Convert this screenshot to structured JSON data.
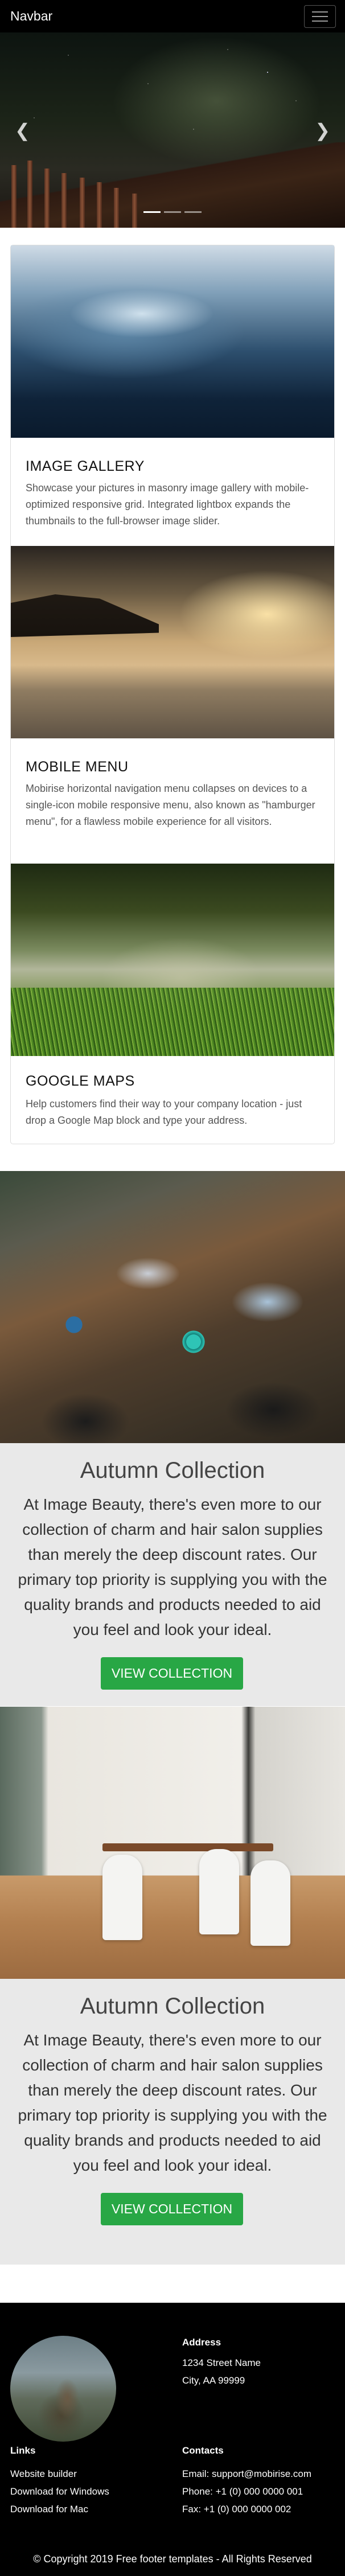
{
  "navbar": {
    "brand": "Navbar"
  },
  "cards": [
    {
      "title": "IMAGE GALLERY",
      "text": "Showcase your pictures in masonry image gallery with mobile-optimized responsive grid. Integrated lightbox expands the thumbnails to the full-browser image slider."
    },
    {
      "title": "MOBILE MENU",
      "text": "Mobirise horizontal navigation menu collapses on devices to a single-icon mobile responsive menu, also known as \"hamburger menu\", for a flawless mobile experience for all visitors."
    },
    {
      "title": "GOOGLE MAPS",
      "text": "Help customers find their way to your company location - just drop a Google Map block and type your address."
    }
  ],
  "sections": [
    {
      "title": "Autumn Collection",
      "text": "At Image Beauty, there's even more to our collection of charm and hair salon supplies than merely the deep discount rates. Our primary top priority is supplying you with the quality brands and products needed to aid you feel and look your ideal.",
      "button": "VIEW COLLECTION"
    },
    {
      "title": "Autumn Collection",
      "text": "At Image Beauty, there's even more to our collection of charm and hair salon supplies than merely the deep discount rates. Our primary top priority is supplying you with the quality brands and products needed to aid you feel and look your ideal.",
      "button": "VIEW COLLECTION"
    }
  ],
  "footer": {
    "address": {
      "heading": "Address",
      "lines": [
        "1234 Street Name",
        "City, AA 99999"
      ]
    },
    "links": {
      "heading": "Links",
      "items": [
        "Website builder",
        "Download for Windows",
        "Download for Mac"
      ]
    },
    "contacts": {
      "heading": "Contacts",
      "lines": [
        "Email: support@mobirise.com",
        "Phone: +1 (0) 000 0000 001",
        "Fax: +1 (0) 000 0000 002"
      ]
    },
    "copyright": "© Copyright 2019 Free footer templates - All Rights Reserved"
  },
  "colors": {
    "navbar_bg": "#000000",
    "button": "#28a745",
    "section_bg": "#e9e9e9",
    "footer_bg": "#000000"
  }
}
